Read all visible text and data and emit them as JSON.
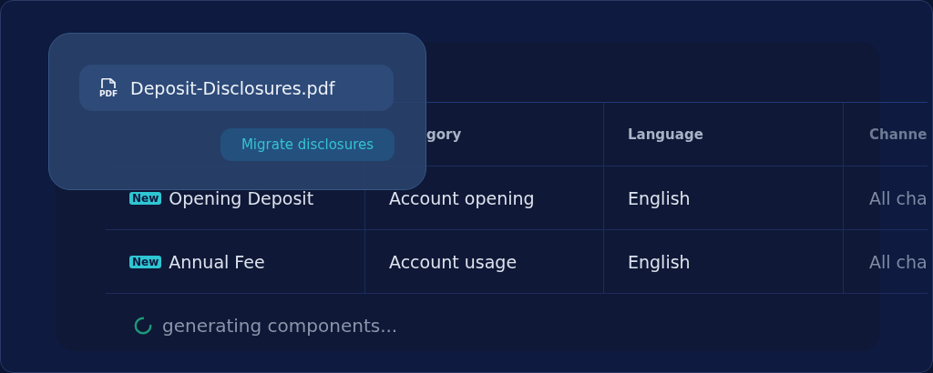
{
  "table": {
    "columns": [
      "gory",
      "Language",
      "Channe"
    ],
    "rows": [
      {
        "badge": "New",
        "name": "Opening Deposit",
        "category": "Account opening",
        "language": "English",
        "channel": "All cha"
      },
      {
        "badge": "New",
        "name": "Annual Fee",
        "category": "Account usage",
        "language": "English",
        "channel": "All cha"
      }
    ]
  },
  "status": "generating components...",
  "popup": {
    "file": "Deposit-Disclosures.pdf",
    "icon_label": "PDF",
    "action": "Migrate disclosures"
  }
}
